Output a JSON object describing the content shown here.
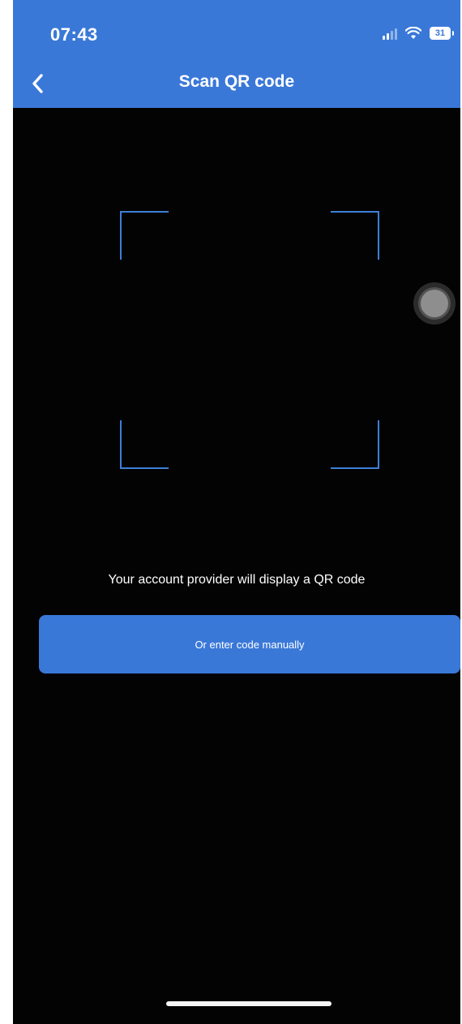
{
  "status_bar": {
    "time": "07:43",
    "battery_level": "31",
    "icons": [
      "signal-icon",
      "wifi-icon",
      "battery-icon"
    ]
  },
  "header": {
    "title": "Scan QR code",
    "back_icon": "chevron-left-icon"
  },
  "scanner": {
    "instruction": "Your account provider will display a QR code",
    "manual_button_label": "Or enter code manually"
  },
  "colors": {
    "accent": "#3a78d8",
    "background": "#030303",
    "frame": "#3f7fd6",
    "text": "#ffffff"
  }
}
